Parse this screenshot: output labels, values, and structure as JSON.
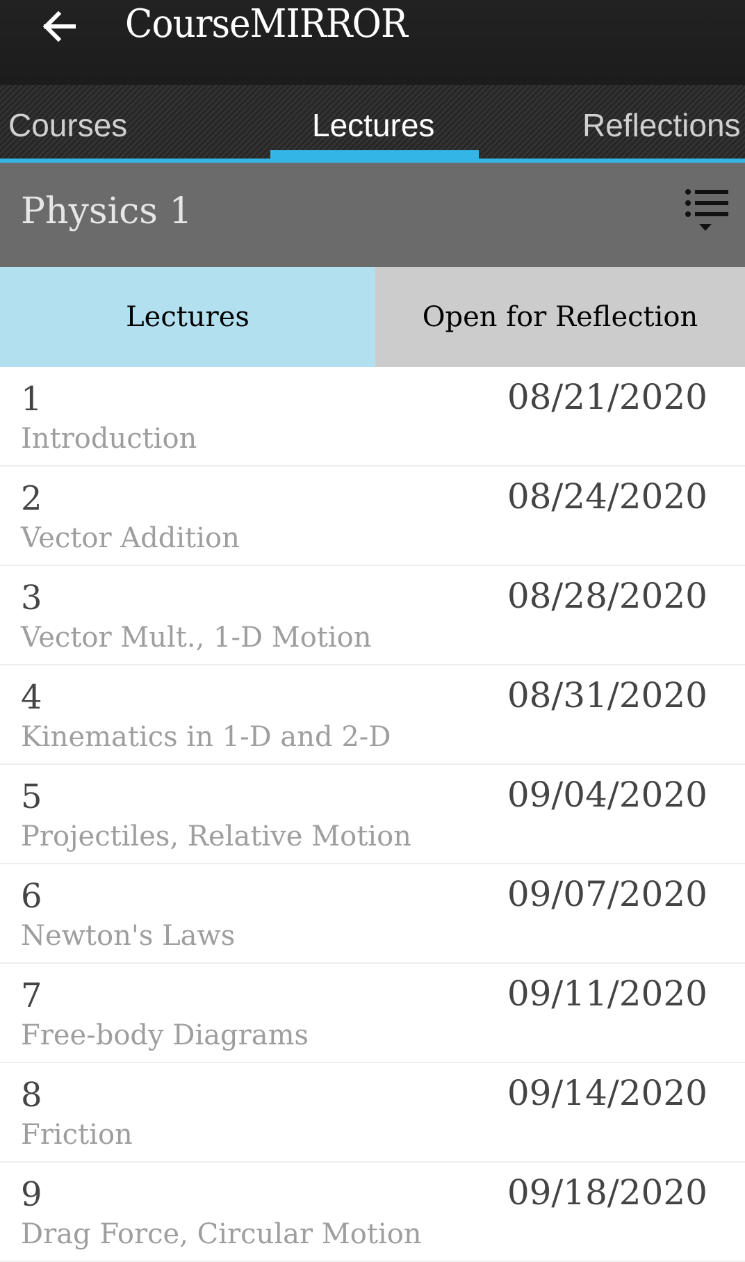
{
  "appbar": {
    "title": "CourseMIRROR",
    "back_icon": "arrow-left-icon"
  },
  "tabs": [
    {
      "label": "Courses",
      "active": false
    },
    {
      "label": "Lectures",
      "active": true
    },
    {
      "label": "Reflections",
      "active": false
    }
  ],
  "colors": {
    "accent": "#33b5e5",
    "segment_active": "#b2e0ef",
    "segment_inactive": "#cccccc",
    "course_bar": "#6b6b6b"
  },
  "course": {
    "name": "Physics 1",
    "filter_icon": "filter-list-icon"
  },
  "segments": [
    {
      "label": "Lectures",
      "active": true
    },
    {
      "label": "Open for Reflection",
      "active": false
    }
  ],
  "lectures": [
    {
      "number": "1",
      "title": "Introduction",
      "date": "08/21/2020"
    },
    {
      "number": "2",
      "title": "Vector Addition",
      "date": "08/24/2020"
    },
    {
      "number": "3",
      "title": "Vector Mult., 1-D Motion",
      "date": "08/28/2020"
    },
    {
      "number": "4",
      "title": "Kinematics in 1-D and 2-D",
      "date": "08/31/2020"
    },
    {
      "number": "5",
      "title": "Projectiles, Relative Motion",
      "date": "09/04/2020"
    },
    {
      "number": "6",
      "title": "Newton's Laws",
      "date": "09/07/2020"
    },
    {
      "number": "7",
      "title": "Free-body Diagrams",
      "date": "09/11/2020"
    },
    {
      "number": "8",
      "title": "Friction",
      "date": "09/14/2020"
    },
    {
      "number": "9",
      "title": "Drag Force, Circular Motion",
      "date": "09/18/2020"
    }
  ]
}
